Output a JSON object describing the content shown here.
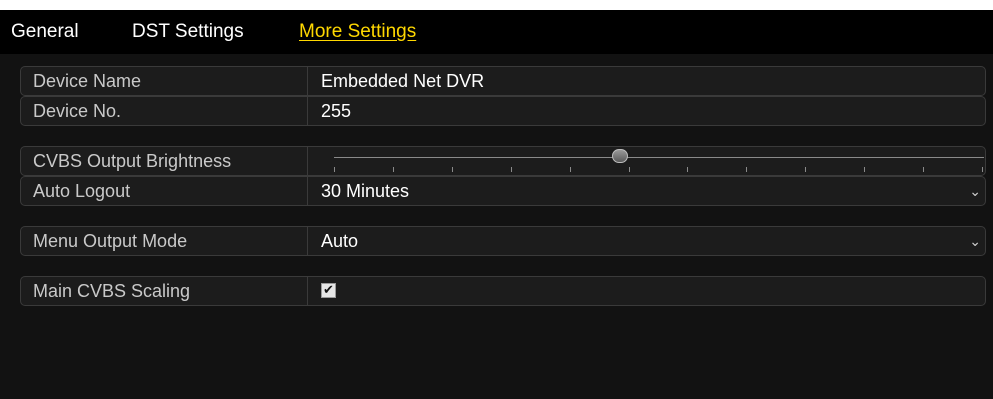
{
  "tabs": [
    {
      "label": "General",
      "active": false
    },
    {
      "label": "DST Settings",
      "active": false
    },
    {
      "label": "More Settings",
      "active": true
    }
  ],
  "settings": {
    "device_name": {
      "label": "Device Name",
      "value": "Embedded Net DVR"
    },
    "device_no": {
      "label": "Device No.",
      "value": "255"
    },
    "cvbs_brightness": {
      "label": "CVBS Output Brightness",
      "level_fraction": 0.44,
      "tick_count": 12
    },
    "auto_logout": {
      "label": "Auto Logout",
      "value": "30 Minutes"
    },
    "menu_output_mode": {
      "label": "Menu Output Mode",
      "value": "Auto"
    },
    "main_cvbs_scaling": {
      "label": "Main CVBS Scaling",
      "checked": true
    }
  },
  "icons": {
    "dropdown": "chevron-down-icon",
    "checkbox": "checkmark-icon"
  },
  "colors": {
    "active_tab": "#ffd800",
    "panel_background": "#121212",
    "tab_bar_background": "#000000"
  }
}
